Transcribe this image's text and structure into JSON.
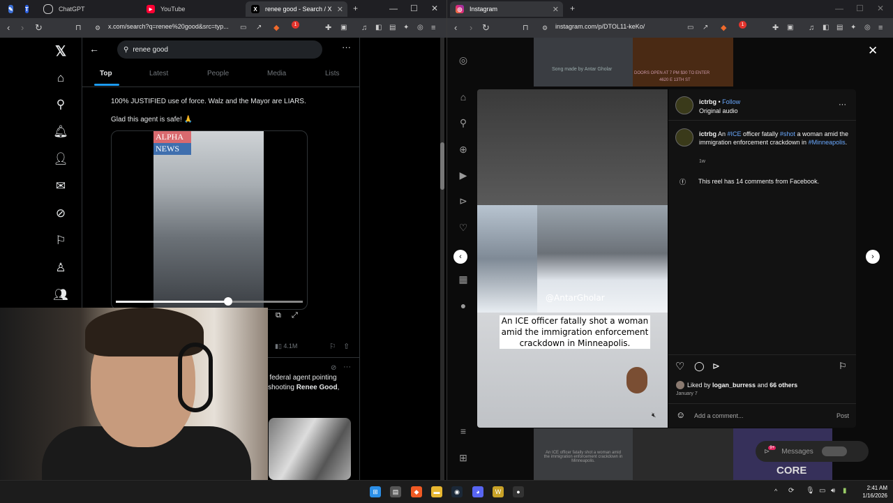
{
  "left_browser": {
    "tabs": [
      {
        "label": ""
      },
      {
        "label": ""
      },
      {
        "label": "ChatGPT"
      },
      {
        "label": "YouTube"
      },
      {
        "label": "renee good - Search / X"
      }
    ],
    "url": "x.com/search?q=renee%20good&src=typ...",
    "shield_count": "1"
  },
  "x_page": {
    "search_value": "renee good",
    "tabs": [
      "Top",
      "Latest",
      "People",
      "Media",
      "Lists"
    ],
    "tweet_line1": "100% JUSTIFIED use of force. Walz and the Mayor are LIARS.",
    "tweet_line2": "Glad this agent is safe! 🙏",
    "video_logo_top": "ALPHA",
    "video_logo_bottom": "NEWS",
    "video_progress": 0.6,
    "views": "4.1M",
    "next_tweet_line1": "n federal agent pointing",
    "next_tweet_line2_prefix": "r shooting ",
    "next_tweet_line2_bold": "Renee Good",
    "next_tweet_line2_suffix": ","
  },
  "right_browser": {
    "tabs": [
      {
        "label": "Instagram"
      }
    ],
    "url": "instagram.com/p/DTOL11-keKo/",
    "shield_count": "1"
  },
  "instagram": {
    "background_text": "Song made by Antar Gholar",
    "background_banner": "DOORS OPEN AT 7 PM  $30 TO ENTER",
    "background_banner2": "4620 E 13TH ST",
    "username": "ictrbg",
    "follow": "Follow",
    "audio": "Original audio",
    "caption_user": "ictrbg",
    "caption_pre": " An ",
    "tag_ice": "#ICE",
    "caption_mid": " officer fatally ",
    "tag_shot": "#shot",
    "caption_post": " a woman amid the immigration enforcement crackdown in ",
    "tag_city": "#Minneapolis",
    "caption_end": ".",
    "caption_time": "1w",
    "facebook_note": "This reel has 14 comments from Facebook.",
    "reel_watermark": "@AntarGholar",
    "reel_caption": "An ICE officer fatally shot a woman amid the immigration enforcement crackdown in Minneapolis.",
    "liked_by_prefix": "Liked by ",
    "liked_by_user": "logan_burress",
    "liked_by_suffix": " and ",
    "liked_by_others": "66 others",
    "post_date": "January 7",
    "comment_placeholder": "Add a comment...",
    "post_button": "Post",
    "below_caption": "An ICE officer fatally shot a woman amid the immigration enforcement crackdown in Minneapolis.",
    "messages": "Messages",
    "messages_badge": "9+",
    "bg_brand": "CORE"
  },
  "taskbar": {
    "time": "2:41 AM",
    "date": "1/16/2026"
  }
}
